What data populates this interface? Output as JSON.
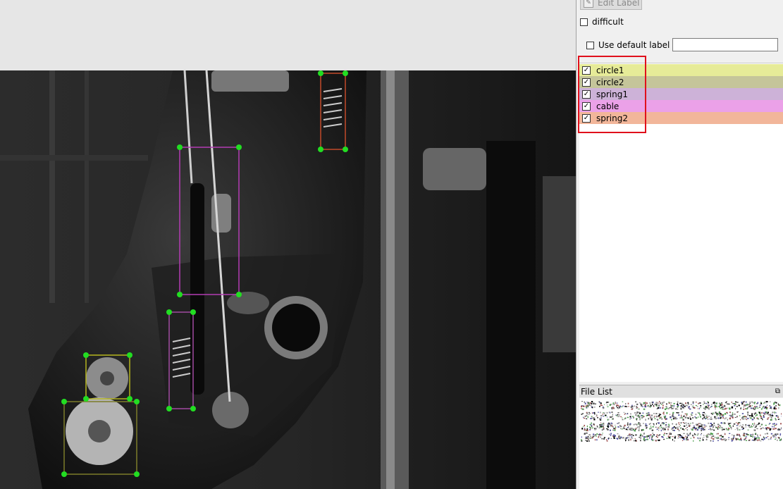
{
  "toolbar": {
    "edit_label": "Edit Label"
  },
  "options": {
    "difficult_label": "difficult",
    "use_default_label": "Use default label",
    "default_label_value": ""
  },
  "labels": [
    {
      "name": "circle1",
      "checked": true,
      "color": "#e6eb98"
    },
    {
      "name": "circle2",
      "checked": true,
      "color": "#c5c59a"
    },
    {
      "name": "spring1",
      "checked": true,
      "color": "#cdb2d8"
    },
    {
      "name": "cable",
      "checked": true,
      "color": "#eba1e8"
    },
    {
      "name": "spring2",
      "checked": true,
      "color": "#f2b69a"
    }
  ],
  "file_list": {
    "title": "File List",
    "restore_icon": "restore-icon"
  },
  "annotations": {
    "point_color": "#22dd22",
    "box_colors": {
      "circle1": "#b5b51e",
      "circle2": "#7d7d2a",
      "spring1": "#a04aa0",
      "cable": "#b33cb3",
      "spring2": "#c24a2a"
    }
  },
  "highlight": {
    "color": "#e0101c"
  }
}
